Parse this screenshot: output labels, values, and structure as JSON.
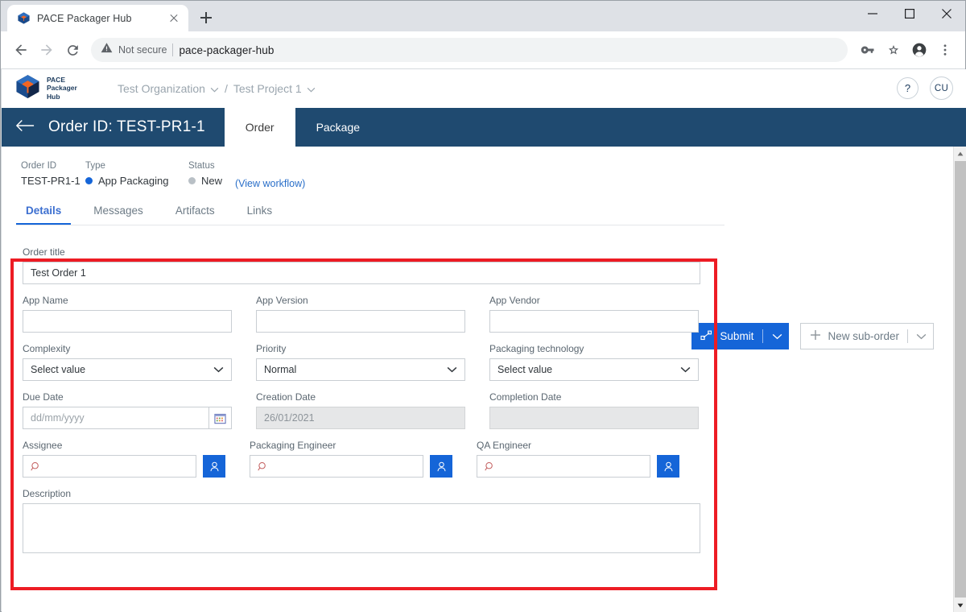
{
  "browser": {
    "tab": {
      "title": "PACE Packager Hub",
      "favicon_icon": "pace-cube-icon",
      "close_icon": "close-icon"
    },
    "new_tab_icon": "plus-icon",
    "window_controls": {
      "minimize": "minimize-icon",
      "maximize": "maximize-icon",
      "close": "close-icon"
    },
    "nav": {
      "back": "back-arrow-icon",
      "forward": "forward-arrow-icon",
      "reload": "reload-icon"
    },
    "omnibox": {
      "warning_icon": "warning-triangle-icon",
      "security_label": "Not secure",
      "url": "pace-packager-hub"
    },
    "toolbar_icons": {
      "password": "key-icon",
      "bookmark": "star-icon",
      "profile": "profile-avatar-icon",
      "menu": "three-dots-menu-icon"
    }
  },
  "app_header": {
    "logo_line1": "PACE",
    "logo_line2": "Packager",
    "logo_line3": "Hub",
    "breadcrumb": [
      {
        "label": "Test Organization",
        "chevron": "chevron-down-icon"
      },
      {
        "label": "Test Project 1",
        "chevron": "chevron-down-icon"
      }
    ],
    "separator": "/",
    "help_label": "?",
    "avatar_label": "CU"
  },
  "order_bar": {
    "back_icon": "back-arrow-icon",
    "title": "Order ID: TEST-PR1-1",
    "tabs": [
      {
        "label": "Order",
        "active": true
      },
      {
        "label": "Package",
        "active": false
      }
    ]
  },
  "meta": {
    "order_id_label": "Order ID",
    "order_id_value": "TEST-PR1-1",
    "type_label": "Type",
    "type_value": "App Packaging",
    "type_dot_color": "#1565d8",
    "status_label": "Status",
    "status_value": "New",
    "status_dot_color": "#b9c0c6",
    "workflow_link": "(View workflow)"
  },
  "actions": {
    "submit_label": "Submit",
    "submit_icon": "workflow-node-icon",
    "submit_chevron": "chevron-down-icon",
    "new_suborder_label": "New sub-order",
    "new_suborder_icon": "plus-icon",
    "new_suborder_chevron": "chevron-down-icon"
  },
  "tabs": [
    {
      "label": "Details",
      "active": true
    },
    {
      "label": "Messages",
      "active": false
    },
    {
      "label": "Artifacts",
      "active": false
    },
    {
      "label": "Links",
      "active": false
    }
  ],
  "form": {
    "order_title": {
      "label": "Order title",
      "value": "Test Order 1"
    },
    "app_name": {
      "label": "App Name",
      "value": ""
    },
    "app_version": {
      "label": "App Version",
      "value": ""
    },
    "app_vendor": {
      "label": "App Vendor",
      "value": ""
    },
    "complexity": {
      "label": "Complexity",
      "value": "Select value"
    },
    "priority": {
      "label": "Priority",
      "value": "Normal"
    },
    "packaging_technology": {
      "label": "Packaging technology",
      "value": "Select value"
    },
    "due_date": {
      "label": "Due Date",
      "placeholder": "dd/mm/yyyy",
      "value": "",
      "icon": "calendar-icon"
    },
    "creation_date": {
      "label": "Creation Date",
      "value": "26/01/2021"
    },
    "completion_date": {
      "label": "Completion Date",
      "value": ""
    },
    "assignee": {
      "label": "Assignee",
      "value": "",
      "search_icon": "search-icon",
      "picker_icon": "user-picker-icon"
    },
    "packaging_engineer": {
      "label": "Packaging Engineer",
      "value": "",
      "search_icon": "search-icon",
      "picker_icon": "user-picker-icon"
    },
    "qa_engineer": {
      "label": "QA Engineer",
      "value": "",
      "search_icon": "search-icon",
      "picker_icon": "user-picker-icon"
    },
    "description": {
      "label": "Description",
      "value": ""
    }
  },
  "annotation": {
    "highlight_color": "#ed1c24"
  },
  "scrollbar": {
    "up_icon": "scroll-up-arrow-icon",
    "down_icon": "scroll-down-arrow-icon"
  }
}
